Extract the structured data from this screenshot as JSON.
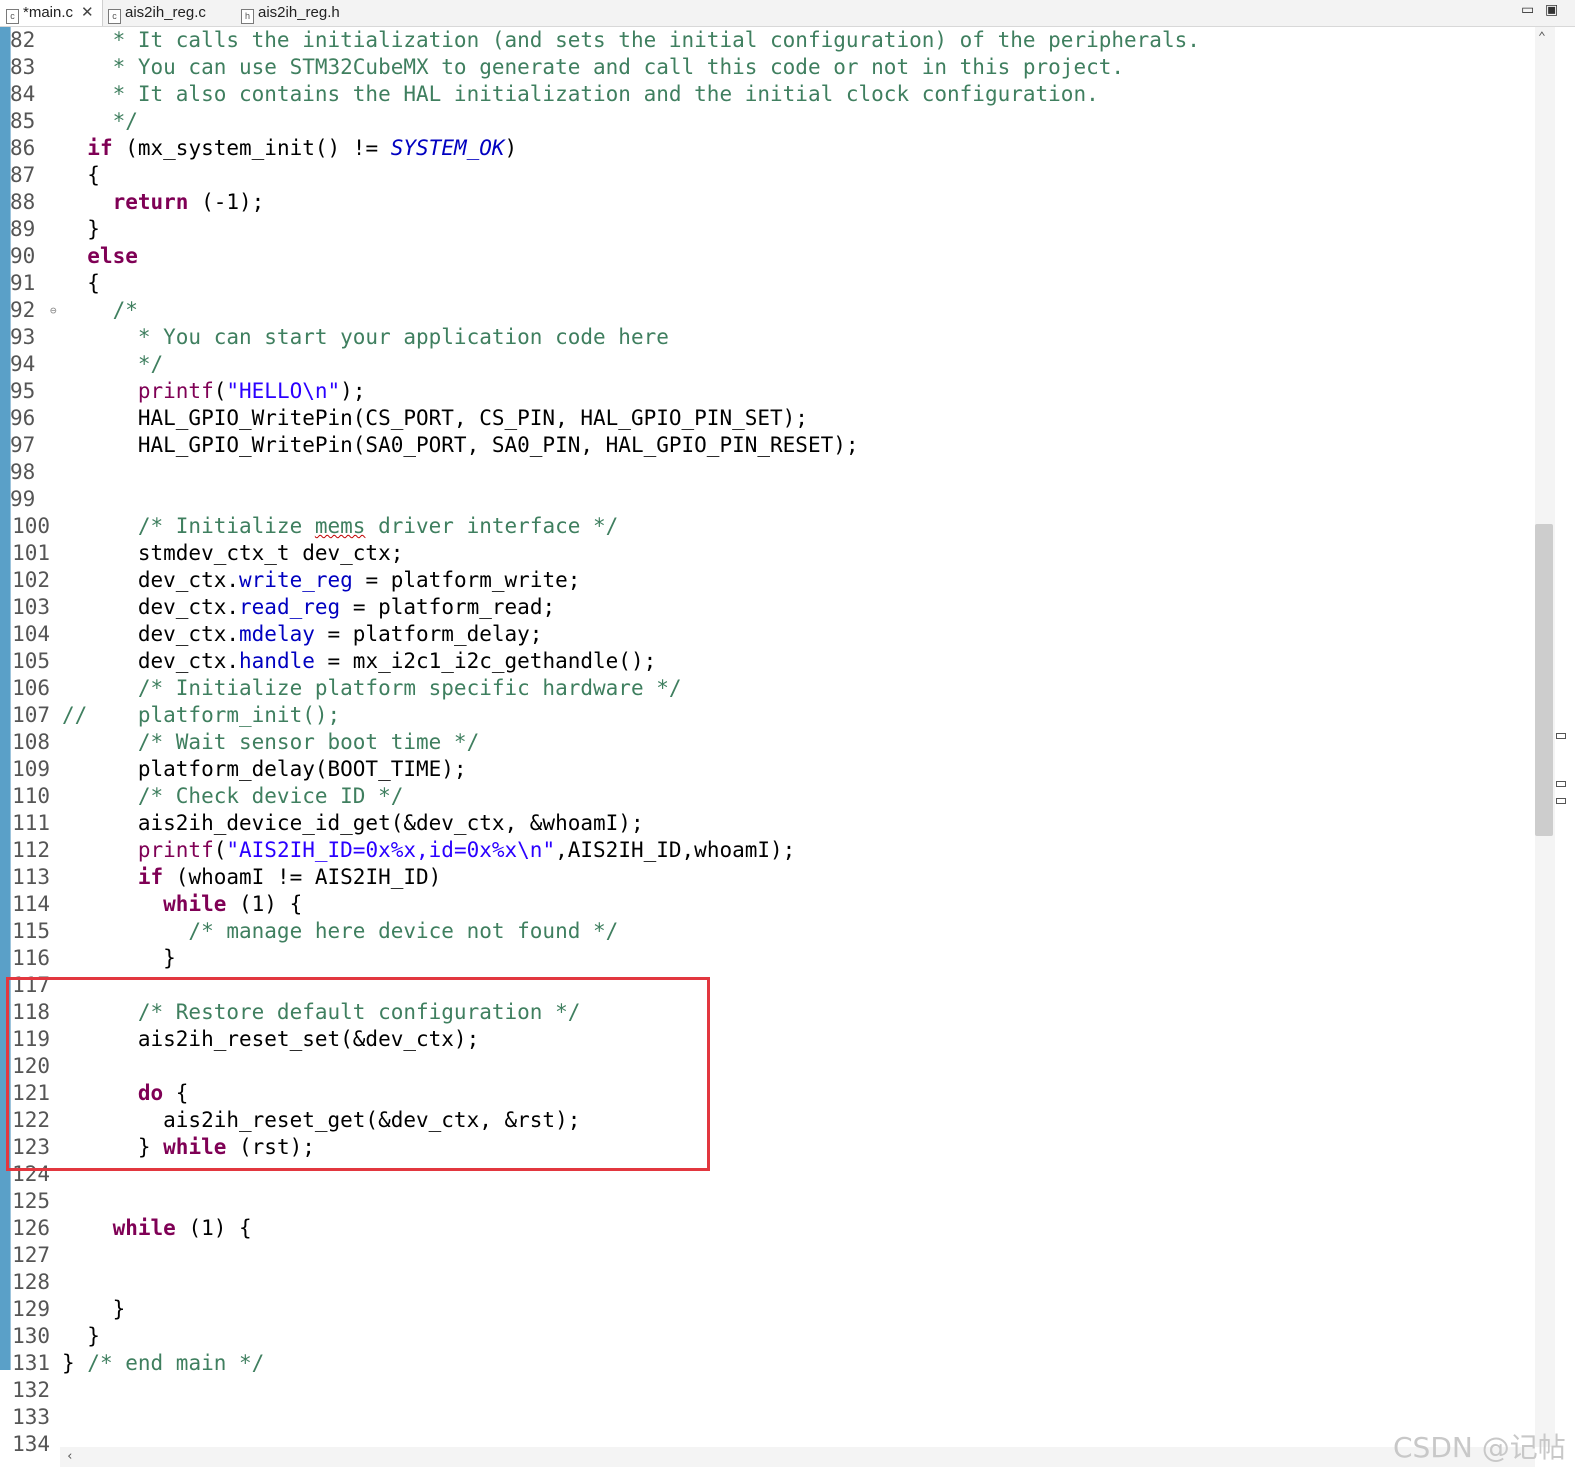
{
  "tabs": [
    {
      "label": "*main.c",
      "icon": "c-file-icon",
      "active": true
    },
    {
      "label": "ais2ih_reg.c",
      "icon": "c-file-icon",
      "active": false
    },
    {
      "label": "ais2ih_reg.h",
      "icon": "h-file-icon",
      "active": false
    }
  ],
  "tab_close": "✕",
  "window": {
    "minimize": "▭",
    "maximize": "▣"
  },
  "editor": {
    "lines": {
      "l82": {
        "num": "82",
        "text": "    * It calls the initialization (and sets the initial configuration) of the peripherals."
      },
      "l83": {
        "num": "83",
        "text": "    * You can use STM32CubeMX to generate and call this code or not in this project."
      },
      "l84": {
        "num": "84",
        "text": "    * It also contains the HAL initialization and the initial clock configuration."
      },
      "l85": {
        "num": "85",
        "text": "    */"
      },
      "l86": {
        "num": "86",
        "pre": "  ",
        "kw": "if",
        "mid": " (mx_system_init() != ",
        "macro": "SYSTEM_OK",
        "post": ")"
      },
      "l87": {
        "num": "87",
        "text": "  {"
      },
      "l88": {
        "num": "88",
        "pre": "    ",
        "kw": "return",
        "post": " (-1);"
      },
      "l89": {
        "num": "89",
        "text": "  }"
      },
      "l90": {
        "num": "90",
        "pre": "  ",
        "kw": "else"
      },
      "l91": {
        "num": "91",
        "text": "  {"
      },
      "l92": {
        "num": "92",
        "fold": "⊖",
        "text": "    /*"
      },
      "l93": {
        "num": "93",
        "text": "      * You can start your application code here"
      },
      "l94": {
        "num": "94",
        "text": "      */"
      },
      "l95": {
        "num": "95",
        "pre": "      ",
        "kw": "printf",
        "open": "(",
        "str": "\"HELLO\\n\"",
        "post": ");"
      },
      "l96": {
        "num": "96",
        "text": "      HAL_GPIO_WritePin(CS_PORT, CS_PIN, HAL_GPIO_PIN_SET);"
      },
      "l97": {
        "num": "97",
        "text": "      HAL_GPIO_WritePin(SA0_PORT, SA0_PIN, HAL_GPIO_PIN_RESET);"
      },
      "l98": {
        "num": "98",
        "text": ""
      },
      "l99": {
        "num": "99",
        "text": ""
      },
      "l100": {
        "num": "100",
        "pre": "      /* Initialize ",
        "spell": "mems",
        "post": " driver interface */"
      },
      "l101": {
        "num": "101",
        "text": "      stmdev_ctx_t dev_ctx;"
      },
      "l102": {
        "num": "102",
        "pre": "      dev_ctx.",
        "field": "write_reg",
        "post": " = platform_write;"
      },
      "l103": {
        "num": "103",
        "pre": "      dev_ctx.",
        "field": "read_reg",
        "post": " = platform_read;"
      },
      "l104": {
        "num": "104",
        "pre": "      dev_ctx.",
        "field": "mdelay",
        "post": " = platform_delay;"
      },
      "l105": {
        "num": "105",
        "pre": "      dev_ctx.",
        "field": "handle",
        "post": " = mx_i2c1_i2c_gethandle();"
      },
      "l106": {
        "num": "106",
        "text": "      /* Initialize platform specific hardware */"
      },
      "l107": {
        "num": "107",
        "text": "//    platform_init();"
      },
      "l108": {
        "num": "108",
        "text": "      /* Wait sensor boot time */"
      },
      "l109": {
        "num": "109",
        "text": "      platform_delay(BOOT_TIME);"
      },
      "l110": {
        "num": "110",
        "text": "      /* Check device ID */"
      },
      "l111": {
        "num": "111",
        "text": "      ais2ih_device_id_get(&dev_ctx, &whoamI);"
      },
      "l112": {
        "num": "112",
        "pre": "      ",
        "kw": "printf",
        "open": "(",
        "str": "\"AIS2IH_ID=0x%x,id=0x%x\\n\"",
        "post": ",AIS2IH_ID,whoamI);"
      },
      "l113": {
        "num": "113",
        "pre": "      ",
        "kw": "if",
        "post": " (whoamI != AIS2IH_ID)"
      },
      "l114": {
        "num": "114",
        "pre": "        ",
        "kw": "while",
        "post": " (1) {"
      },
      "l115": {
        "num": "115",
        "text": "          /* manage here device not found */"
      },
      "l116": {
        "num": "116",
        "text": "        }"
      },
      "l117": {
        "num": "117",
        "text": ""
      },
      "l118": {
        "num": "118",
        "text": "      /* Restore default configuration */"
      },
      "l119": {
        "num": "119",
        "text": "      ais2ih_reset_set(&dev_ctx);"
      },
      "l120": {
        "num": "120",
        "text": ""
      },
      "l121": {
        "num": "121",
        "pre": "      ",
        "kw": "do",
        "post": " {"
      },
      "l122": {
        "num": "122",
        "text": "        ais2ih_reset_get(&dev_ctx, &rst);"
      },
      "l123": {
        "num": "123",
        "pre": "      } ",
        "kw": "while",
        "post": " (rst);"
      },
      "l124": {
        "num": "124",
        "text": ""
      },
      "l125": {
        "num": "125",
        "text": ""
      },
      "l126": {
        "num": "126",
        "pre": "    ",
        "kw": "while",
        "post": " (1) {"
      },
      "l127": {
        "num": "127",
        "text": ""
      },
      "l128": {
        "num": "128",
        "text": ""
      },
      "l129": {
        "num": "129",
        "text": "    }"
      },
      "l130": {
        "num": "130",
        "text": "  }"
      },
      "l131": {
        "num": "131",
        "pre": "} ",
        "cmt": "/* end main */"
      },
      "l132": {
        "num": "132",
        "text": ""
      },
      "l133": {
        "num": "133",
        "text": ""
      },
      "l134": {
        "num": "134",
        "text": ""
      }
    }
  },
  "scroll": {
    "up": "⌃",
    "left": "‹"
  },
  "watermark": "CSDN @记帖",
  "colors": {
    "keyword": "#7f0055",
    "comment": "#3f7f5f",
    "string": "#2a00ff",
    "field": "#0000c0",
    "highlight_box": "#e2373f"
  }
}
